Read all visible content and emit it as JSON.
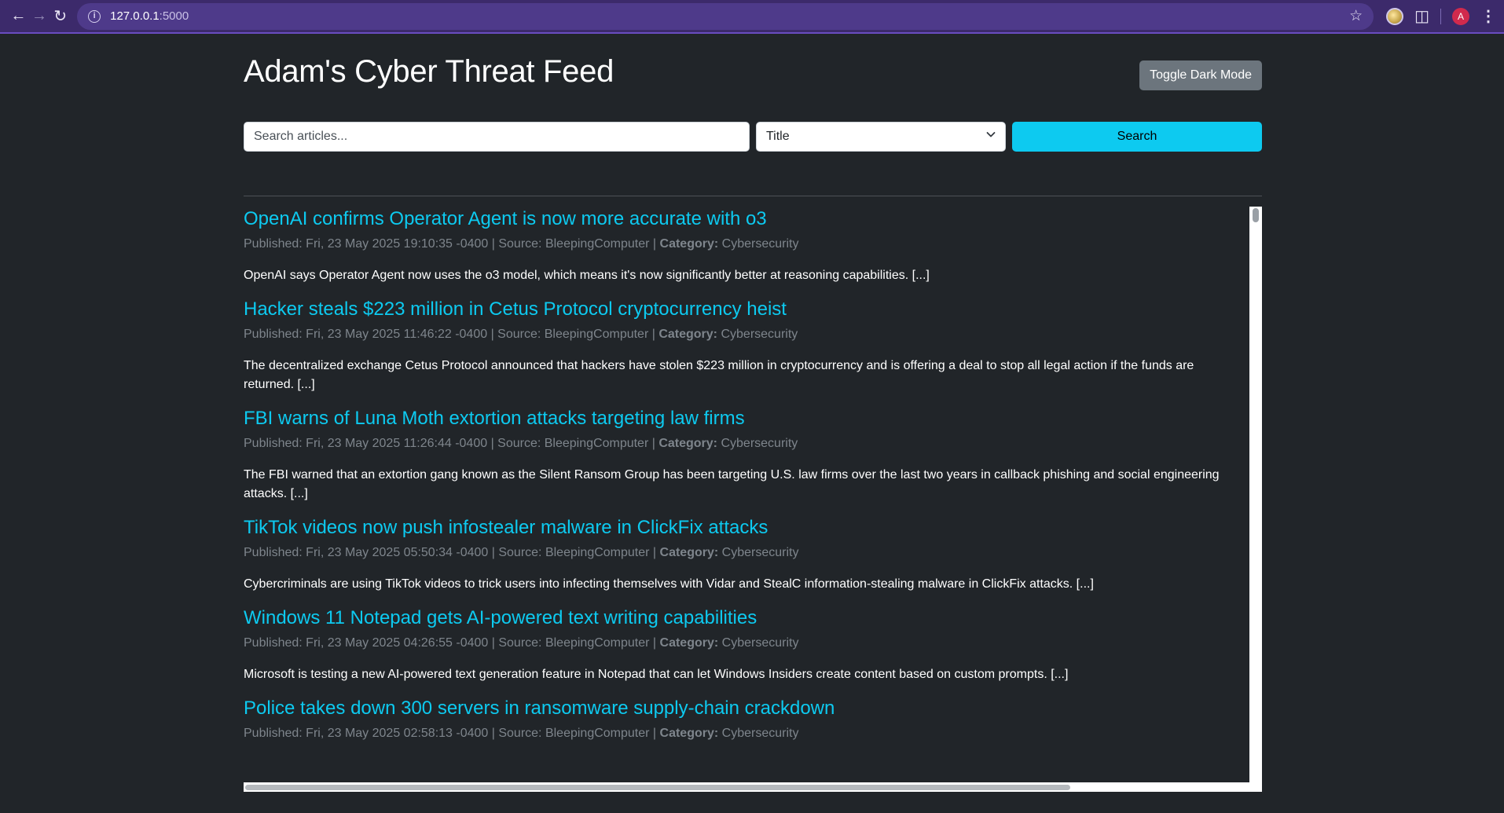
{
  "browser": {
    "url_host": "127.0.0.1",
    "url_port": ":5000",
    "avatar_letter": "A"
  },
  "header": {
    "title": "Adam's Cyber Threat Feed",
    "toggle_label": "Toggle Dark Mode"
  },
  "search": {
    "placeholder": "Search articles...",
    "value": "",
    "field_selected": "Title",
    "button_label": "Search"
  },
  "colors": {
    "background": "#212529",
    "accent": "#0dcaf0",
    "secondary_button": "#6c757d",
    "browser_chrome": "#3c2a6b"
  },
  "articles": [
    {
      "title": "OpenAI confirms Operator Agent is now more accurate with o3",
      "meta_prefix": "Published: Fri, 23 May 2025 19:10:35 -0400 | Source: BleepingComputer | ",
      "category_label": "Category:",
      "category": " Cybersecurity",
      "summary": "OpenAI says Operator Agent now uses the o3 model, which means it's now significantly better at reasoning capabilities. [...]"
    },
    {
      "title": "Hacker steals $223 million in Cetus Protocol cryptocurrency heist",
      "meta_prefix": "Published: Fri, 23 May 2025 11:46:22 -0400 | Source: BleepingComputer | ",
      "category_label": "Category:",
      "category": " Cybersecurity",
      "summary": "The decentralized exchange Cetus Protocol announced that hackers have stolen $223 million in cryptocurrency and is offering a deal to stop all legal action if the funds are returned. [...]"
    },
    {
      "title": "FBI warns of Luna Moth extortion attacks targeting law firms",
      "meta_prefix": "Published: Fri, 23 May 2025 11:26:44 -0400 | Source: BleepingComputer | ",
      "category_label": "Category:",
      "category": " Cybersecurity",
      "summary": "The FBI warned that an extortion gang known as the Silent Ransom Group has been targeting U.S. law firms over the last two years in callback phishing and social engineering attacks. [...]"
    },
    {
      "title": "TikTok videos now push infostealer malware in ClickFix attacks",
      "meta_prefix": "Published: Fri, 23 May 2025 05:50:34 -0400 | Source: BleepingComputer | ",
      "category_label": "Category:",
      "category": " Cybersecurity",
      "summary": "Cybercriminals are using TikTok videos to trick users into infecting themselves with Vidar and StealC information-stealing malware in ClickFix attacks. [...]"
    },
    {
      "title": "Windows 11 Notepad gets AI-powered text writing capabilities",
      "meta_prefix": "Published: Fri, 23 May 2025 04:26:55 -0400 | Source: BleepingComputer | ",
      "category_label": "Category:",
      "category": " Cybersecurity",
      "summary": "Microsoft is testing a new AI-powered text generation feature in Notepad that can let Windows Insiders create content based on custom prompts. [...]"
    },
    {
      "title": "Police takes down 300 servers in ransomware supply-chain crackdown",
      "meta_prefix": "Published: Fri, 23 May 2025 02:58:13 -0400 | Source: BleepingComputer | ",
      "category_label": "Category:",
      "category": " Cybersecurity",
      "summary": ""
    }
  ]
}
